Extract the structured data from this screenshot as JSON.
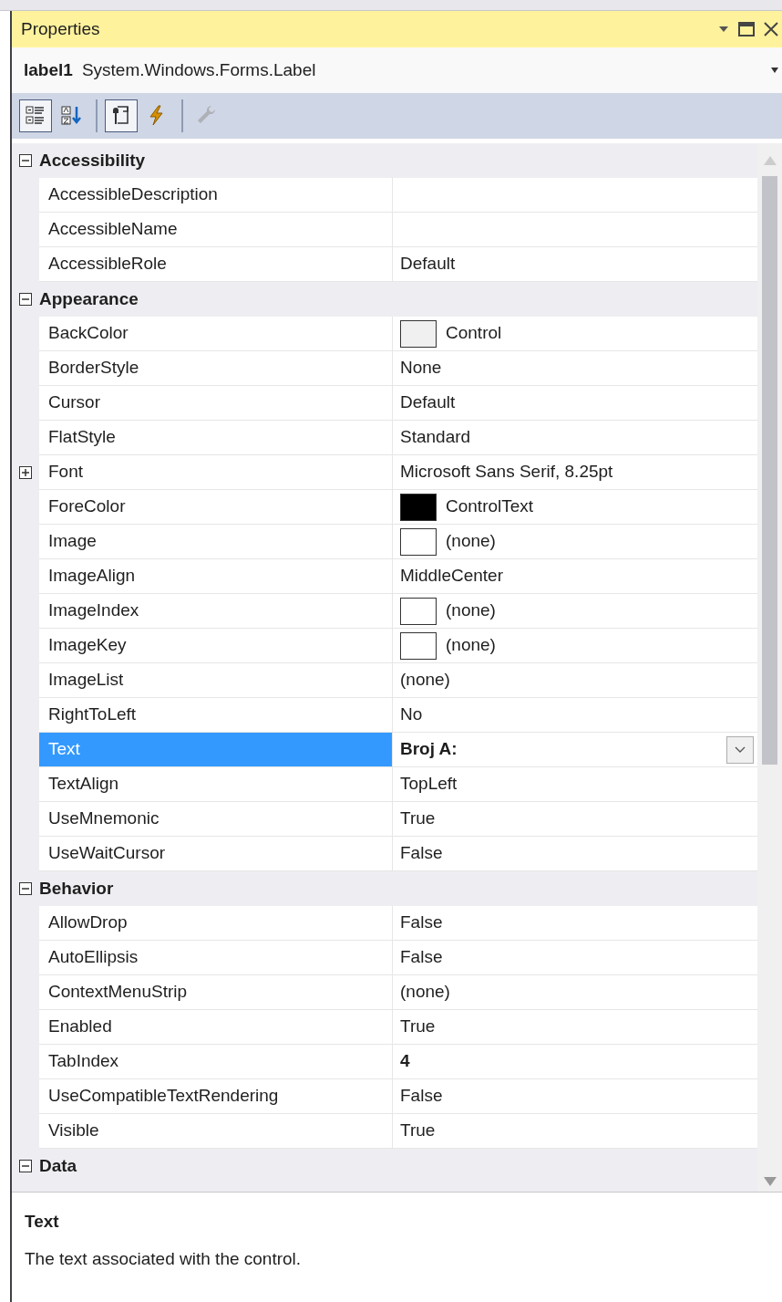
{
  "window": {
    "title": "Properties"
  },
  "object_selector": {
    "name": "label1",
    "type": "System.Windows.Forms.Label"
  },
  "toolbar": [
    {
      "kind": "categorized",
      "selected": true,
      "disabled": false
    },
    {
      "kind": "alphabetical",
      "selected": false,
      "disabled": false
    },
    {
      "kind": "separator"
    },
    {
      "kind": "properties",
      "selected": true,
      "disabled": false
    },
    {
      "kind": "events",
      "selected": false,
      "disabled": false
    },
    {
      "kind": "separator"
    },
    {
      "kind": "pages",
      "selected": false,
      "disabled": true
    }
  ],
  "categories": [
    {
      "name": "Accessibility",
      "expanded": true,
      "items": [
        {
          "name": "AccessibleDescription",
          "kind": "text",
          "selected": false
        },
        {
          "name": "AccessibleName",
          "kind": "text",
          "selected": false
        },
        {
          "name": "AccessibleRole",
          "value": "Default",
          "kind": "text",
          "selected": false,
          "modified": false
        }
      ]
    },
    {
      "name": "Appearance",
      "expanded": true,
      "items": [
        {
          "name": "BackColor",
          "value": "Control",
          "kind": "swatch",
          "color": "#f0f0f0",
          "selected": false,
          "modified": false
        },
        {
          "name": "BorderStyle",
          "value": "None",
          "kind": "text",
          "selected": false,
          "modified": false
        },
        {
          "name": "Cursor",
          "value": "Default",
          "kind": "text",
          "selected": false,
          "modified": false
        },
        {
          "name": "FlatStyle",
          "value": "Standard",
          "kind": "text",
          "selected": false,
          "modified": false
        },
        {
          "name": "Font",
          "value": "Microsoft Sans Serif, 8.25pt",
          "kind": "group",
          "expanded": false,
          "selected": false,
          "modified": false
        },
        {
          "name": "ForeColor",
          "value": "ControlText",
          "kind": "swatch",
          "color": "#000000",
          "selected": false,
          "modified": false
        },
        {
          "name": "Image",
          "value": "(none)",
          "kind": "swatch",
          "color": "#ffffff",
          "selected": false,
          "modified": false
        },
        {
          "name": "ImageAlign",
          "value": "MiddleCenter",
          "kind": "text",
          "selected": false,
          "modified": false
        },
        {
          "name": "ImageIndex",
          "value": "(none)",
          "kind": "swatch",
          "color": "#ffffff",
          "selected": false,
          "modified": false
        },
        {
          "name": "ImageKey",
          "value": "(none)",
          "kind": "swatch",
          "color": "#ffffff",
          "selected": false,
          "modified": false
        },
        {
          "name": "ImageList",
          "value": "(none)",
          "kind": "text",
          "selected": false,
          "modified": false
        },
        {
          "name": "RightToLeft",
          "value": "No",
          "kind": "text",
          "selected": false,
          "modified": false
        },
        {
          "name": "Text",
          "value": "Broj A:",
          "kind": "text",
          "selected": true,
          "modified": true
        },
        {
          "name": "TextAlign",
          "value": "TopLeft",
          "kind": "text",
          "selected": false,
          "modified": false
        },
        {
          "name": "UseMnemonic",
          "value": "True",
          "kind": "text",
          "selected": false,
          "modified": false
        },
        {
          "name": "UseWaitCursor",
          "value": "False",
          "kind": "text",
          "selected": false,
          "modified": false
        }
      ]
    },
    {
      "name": "Behavior",
      "expanded": true,
      "items": [
        {
          "name": "AllowDrop",
          "value": "False",
          "kind": "text",
          "selected": false,
          "modified": false
        },
        {
          "name": "AutoEllipsis",
          "value": "False",
          "kind": "text",
          "selected": false,
          "modified": false
        },
        {
          "name": "ContextMenuStrip",
          "value": "(none)",
          "kind": "text",
          "selected": false,
          "modified": false
        },
        {
          "name": "Enabled",
          "value": "True",
          "kind": "text",
          "selected": false,
          "modified": false
        },
        {
          "name": "TabIndex",
          "value": "4",
          "kind": "text",
          "selected": false,
          "modified": true
        },
        {
          "name": "UseCompatibleTextRendering",
          "value": "False",
          "kind": "text",
          "selected": false,
          "modified": false
        },
        {
          "name": "Visible",
          "value": "True",
          "kind": "text",
          "selected": false,
          "modified": false
        }
      ]
    },
    {
      "name": "Data",
      "expanded": true
    }
  ],
  "description": {
    "title": "Text",
    "text": "The text associated with the control."
  }
}
